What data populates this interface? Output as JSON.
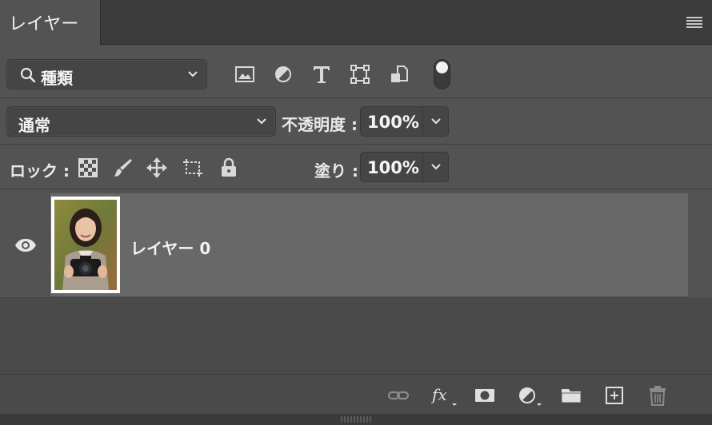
{
  "panel": {
    "tab_label": "レイヤー",
    "menu_icon": "hamburger-menu-icon"
  },
  "filter": {
    "search_icon": "magnifier-icon",
    "kind_value": "種類",
    "icons": [
      "image-filter-icon",
      "adjustment-filter-icon",
      "type-filter-icon",
      "shape-filter-icon",
      "smart-object-filter-icon"
    ],
    "toggle_on": true
  },
  "blend": {
    "mode_value": "通常",
    "opacity_label": "不透明度 :",
    "opacity_value": "100%"
  },
  "lock": {
    "label": "ロック :",
    "icons": [
      "lock-transparent-pixels-icon",
      "lock-image-pixels-icon",
      "lock-position-icon",
      "lock-artboard-icon",
      "lock-all-icon"
    ],
    "fill_label": "塗り :",
    "fill_value": "100%"
  },
  "layers": [
    {
      "name": "レイヤー 0",
      "visible": true,
      "selected": true
    }
  ],
  "footer": {
    "icons": [
      "link-layers-icon",
      "fx-icon",
      "layer-mask-icon",
      "adjustment-layer-icon",
      "group-folder-icon",
      "new-layer-icon",
      "trash-icon"
    ]
  },
  "colors": {
    "panel_bg": "#535353",
    "selected_row": "#686868",
    "tab_strip": "#3c3c3c"
  }
}
